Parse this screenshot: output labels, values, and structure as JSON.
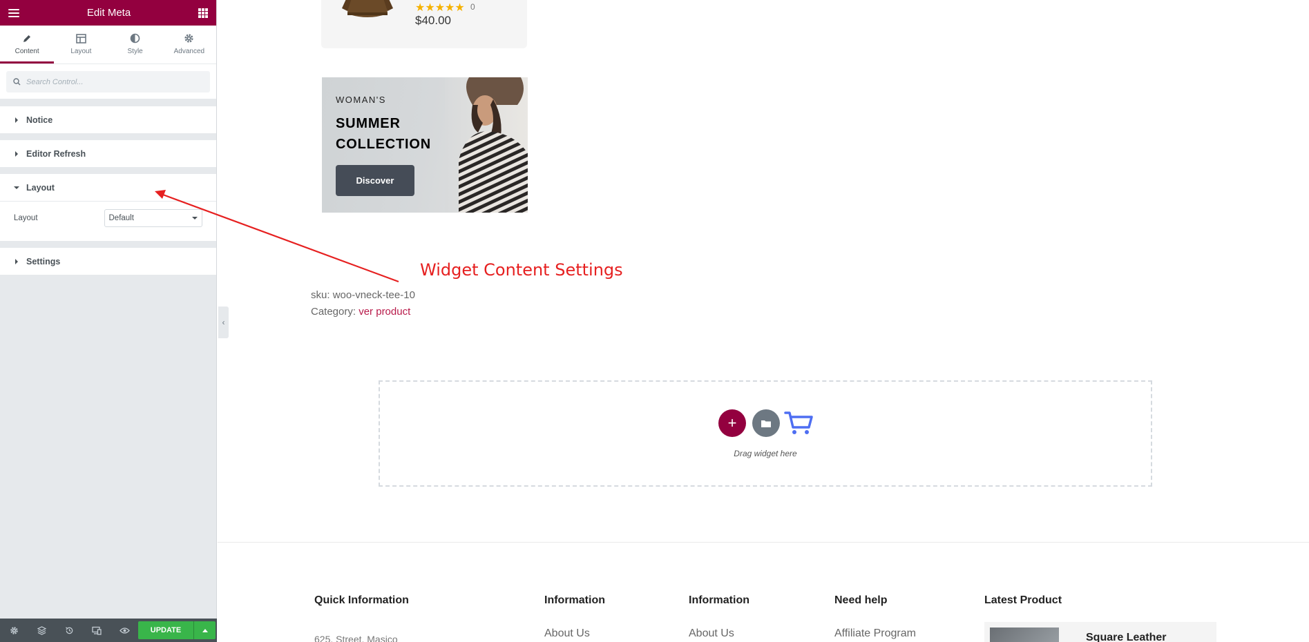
{
  "panel": {
    "title": "Edit Meta",
    "tabs": [
      {
        "label": "Content",
        "icon": "pencil-icon",
        "active": true
      },
      {
        "label": "Layout",
        "icon": "layout-icon",
        "active": false
      },
      {
        "label": "Style",
        "icon": "contrast-icon",
        "active": false
      },
      {
        "label": "Advanced",
        "icon": "gear-icon",
        "active": false
      }
    ],
    "search_placeholder": "Search Control...",
    "sections": {
      "notice": "Notice",
      "editor_refresh": "Editor Refresh",
      "layout": "Layout",
      "settings": "Settings"
    },
    "layout_control": {
      "label": "Layout",
      "value": "Default"
    },
    "footer": {
      "update_label": "UPDATE"
    },
    "accent_color": "#93003f",
    "update_color": "#39b54a"
  },
  "preview": {
    "product": {
      "rating": "★★★★★",
      "review_count": "0",
      "price": "$40.00"
    },
    "banner": {
      "subtitle": "WOMAN'S",
      "title": "SUMMER COLLECTION",
      "button": "Discover"
    },
    "annotation": "Widget Content Settings",
    "meta": {
      "sku_label": "sku:",
      "sku_value": "woo-vneck-tee-10",
      "category_label": "Category:",
      "category_value": "ver product"
    },
    "dropzone": {
      "label": "Drag widget here"
    },
    "footer": {
      "columns": [
        {
          "title": "Quick Information",
          "first_item": "625, Street, Masico"
        },
        {
          "title": "Information",
          "first_item": "About Us"
        },
        {
          "title": "Information",
          "first_item": "About Us"
        },
        {
          "title": "Need help",
          "first_item": "Affiliate Program"
        },
        {
          "title": "Latest Product",
          "first_item": "Square Leather"
        }
      ]
    }
  }
}
